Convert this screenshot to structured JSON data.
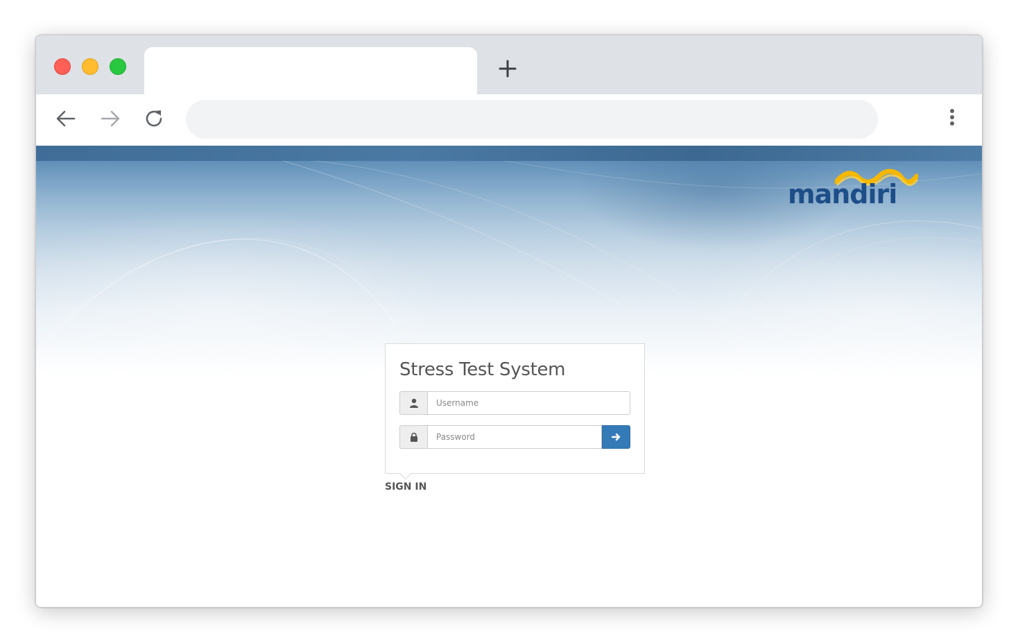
{
  "browser": {
    "active_tab_title": "",
    "address_bar_value": "",
    "icons": {
      "new_tab": "plus-icon",
      "back": "arrow-left-icon",
      "forward": "arrow-right-icon",
      "reload": "reload-icon",
      "menu": "kebab-menu-icon"
    }
  },
  "brand": {
    "logo_text": "mandiri",
    "logo_color": "#1e4e88",
    "wave_color": "#f5b700"
  },
  "login": {
    "title": "Stress Test System",
    "username_placeholder": "Username",
    "password_placeholder": "Password",
    "submit_icon": "arrow-right-icon",
    "submit_color": "#337ab7",
    "user_icon": "user-icon",
    "lock_icon": "lock-icon"
  },
  "footer_label": "SIGN IN"
}
